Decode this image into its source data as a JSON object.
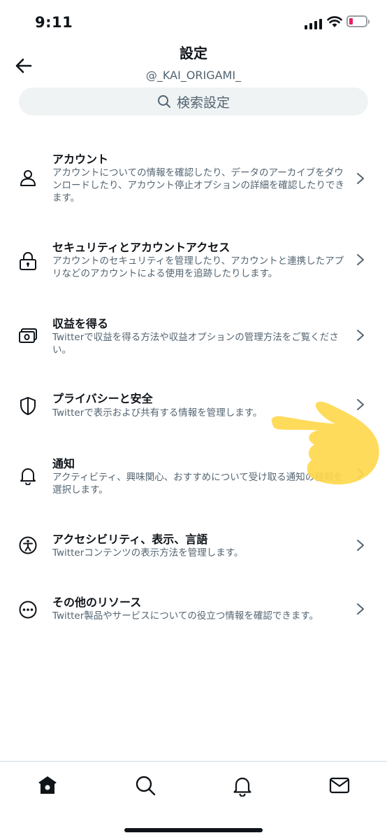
{
  "status_bar": {
    "time": "9:11"
  },
  "header": {
    "title": "設定",
    "handle": "@_KAI_ORIGAMI_",
    "back_icon": "arrow-left-icon"
  },
  "search": {
    "placeholder": "検索設定",
    "icon": "search-icon"
  },
  "menu": [
    {
      "title": "アカウント",
      "description": "アカウントについての情報を確認したり、データのアーカイブをダウンロードしたり、アカウント停止オプションの詳細を確認したりできます。",
      "icon": "person-icon"
    },
    {
      "title": "セキュリティとアカウントアクセス",
      "description": "アカウントのセキュリティを管理したり、アカウントと連携したアプリなどのアカウントによる使用を追跡したりします。",
      "icon": "lock-icon"
    },
    {
      "title": "収益を得る",
      "description": "Twitterで収益を得る方法や収益オプションの管理方法をご覧ください。",
      "icon": "money-icon"
    },
    {
      "title": "プライバシーと安全",
      "description": "Twitterで表示および共有する情報を管理します。",
      "icon": "shield-icon"
    },
    {
      "title": "通知",
      "description": "アクティビティ、興味関心、おすすめについて受け取る通知の種類を選択します。",
      "icon": "bell-icon"
    },
    {
      "title": "アクセシビリティ、表示、言語",
      "description": "Twitterコンテンツの表示方法を管理します。",
      "icon": "accessibility-icon"
    },
    {
      "title": "その他のリソース",
      "description": "Twitter製品やサービスについての役立つ情報を確認できます。",
      "icon": "more-icon"
    }
  ],
  "tabbar": [
    "home-icon",
    "search-icon",
    "bell-icon",
    "mail-icon"
  ],
  "colors": {
    "text": "#0f1419",
    "secondary": "#536471",
    "search_bg": "#eff3f4",
    "finger": "#ffd84d",
    "battery_low": "#e0245e"
  }
}
